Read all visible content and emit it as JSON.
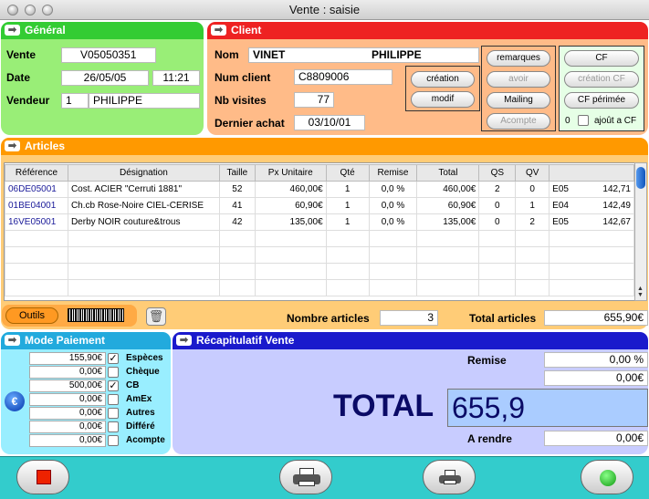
{
  "window": {
    "title": "Vente : saisie"
  },
  "general": {
    "header": "Général",
    "vente_label": "Vente",
    "vente": "V05050351",
    "date_label": "Date",
    "date": "26/05/05",
    "time": "11:21",
    "vendeur_label": "Vendeur",
    "vendeur_num": "1",
    "vendeur_name": "PHILIPPE"
  },
  "client": {
    "header": "Client",
    "nom_label": "Nom",
    "nom": "VINET",
    "prenom": "PHILIPPE",
    "num_label": "Num client",
    "num": "C8809006",
    "visites_label": "Nb visites",
    "visites": "77",
    "achat_label": "Dernier achat",
    "achat": "03/10/01",
    "creation": "création",
    "modif": "modif",
    "remarques": "remarques",
    "avoir": "avoir",
    "mailing": "Mailing",
    "acompte": "Acompte",
    "cf": "CF",
    "creation_cf": "création CF",
    "cf_perimee": "CF périmée",
    "cf_count": "0",
    "ajout_cf": "ajoût a CF"
  },
  "articles": {
    "header": "Articles",
    "columns": [
      "Référence",
      "Désignation",
      "Taille",
      "Px Unitaire",
      "Qté",
      "Remise",
      "Total",
      "QS",
      "QV",
      ""
    ],
    "rows": [
      {
        "ref": "06DE05001",
        "des": "Cost. ACIER \"Cerruti 1881\"",
        "taille": "52",
        "px": "460,00€",
        "qte": "1",
        "remise": "0,0 %",
        "total": "460,00€",
        "qs": "2",
        "qv": "0",
        "code": "E05",
        "val": "142,71"
      },
      {
        "ref": "01BE04001",
        "des": "Ch.cb Rose-Noire CIEL-CERISE",
        "taille": "41",
        "px": "60,90€",
        "qte": "1",
        "remise": "0,0 %",
        "total": "60,90€",
        "qs": "0",
        "qv": "1",
        "code": "E04",
        "val": "142,49"
      },
      {
        "ref": "16VE05001",
        "des": "Derby NOIR couture&trous",
        "taille": "42",
        "px": "135,00€",
        "qte": "1",
        "remise": "0,0 %",
        "total": "135,00€",
        "qs": "0",
        "qv": "2",
        "code": "E05",
        "val": "142,67"
      }
    ],
    "outils": "Outils",
    "nombre_label": "Nombre articles",
    "nombre": "3",
    "total_label": "Total articles",
    "total": "655,90€"
  },
  "paiement": {
    "header": "Mode Paiement",
    "items": [
      {
        "amount": "155,90€",
        "label": "Espèces",
        "checked": true
      },
      {
        "amount": "0,00€",
        "label": "Chèque",
        "checked": false
      },
      {
        "amount": "500,00€",
        "label": "CB",
        "checked": true
      },
      {
        "amount": "0,00€",
        "label": "AmEx",
        "checked": false
      },
      {
        "amount": "0,00€",
        "label": "Autres",
        "checked": false
      },
      {
        "amount": "0,00€",
        "label": "Différé",
        "checked": false
      },
      {
        "amount": "0,00€",
        "label": "Acompte",
        "checked": false
      }
    ],
    "euro": "€"
  },
  "recap": {
    "header": "Récapitulatif Vente",
    "remise_label": "Remise",
    "remise_pct": "0,00 %",
    "remise_amt": "0,00€",
    "total_label": "TOTAL",
    "total": "655,9",
    "rendre_label": "A rendre",
    "rendre": "0,00€"
  },
  "colors": {
    "general": "#33cc33",
    "client": "#ee2222",
    "articles": "#ff9900",
    "paiement": "#22aadd",
    "recap": "#1a1acc",
    "bottom": "#33cccc"
  }
}
